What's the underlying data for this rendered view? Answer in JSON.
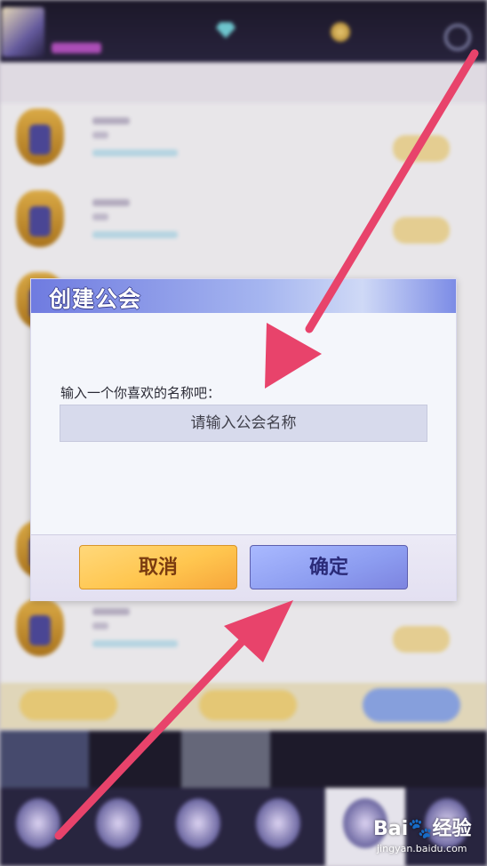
{
  "dialog": {
    "title": "创建公会",
    "prompt": "输入一个你喜欢的名称吧：",
    "input_placeholder": "请输入公会名称",
    "input_value": "",
    "cancel_label": "取消",
    "confirm_label": "确定"
  },
  "watermark": {
    "logo": "Bai🐾经验",
    "url": "jingyan.baidu.com"
  },
  "colors": {
    "arrow": "#e8436b",
    "header_accent": "#6f7be0",
    "cancel_button": "#ffc64f",
    "confirm_button": "#8c9cf0"
  },
  "icons": [
    "gem-icon",
    "gold-coin-icon",
    "settings-gear-icon",
    "guild-emblem-icon",
    "nav-tab-icon"
  ]
}
